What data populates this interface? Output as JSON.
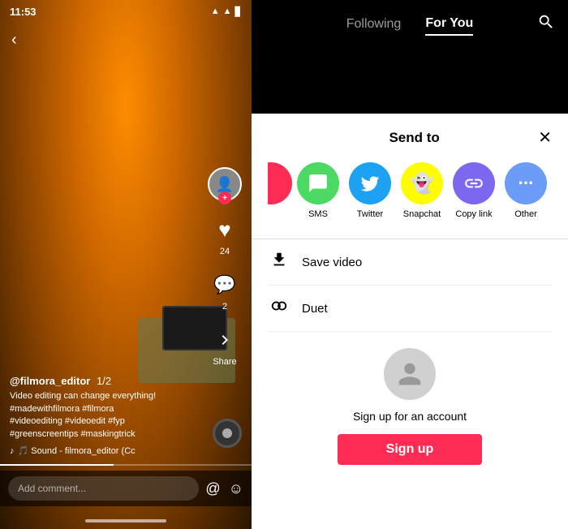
{
  "left_panel": {
    "status_time": "11:53",
    "username": "@filmora_editor",
    "date": "1/2",
    "caption": "Video editing can change everything!\n#madewithfilmora #filmora\n#videoediting #videoedit #fyp\n#greenscreentips #maskingtrick",
    "music": "🎵 Sound - filmora_editor (Cc",
    "comment_placeholder": "Add comment...",
    "like_count": "24",
    "comment_count": "2"
  },
  "right_panel": {
    "nav": {
      "following_label": "Following",
      "for_you_label": "For You",
      "active_tab": "for_you"
    },
    "send_to": {
      "title": "Send to",
      "close_icon": "✕",
      "share_items": [
        {
          "id": "sms",
          "label": "SMS",
          "bg_class": "sms-circle",
          "icon": "💬"
        },
        {
          "id": "twitter",
          "label": "Twitter",
          "bg_class": "twitter-circle",
          "icon": "🐦"
        },
        {
          "id": "snapchat",
          "label": "Snapchat",
          "bg_class": "snapchat-circle",
          "icon": "👻"
        },
        {
          "id": "copy_link",
          "label": "Copy link",
          "bg_class": "copylink-circle",
          "icon": "🔗"
        },
        {
          "id": "other",
          "label": "Other",
          "bg_class": "other-circle",
          "icon": "···"
        }
      ],
      "save_video_label": "Save video",
      "duet_label": "Duet",
      "signup_prompt": "Sign up for an account",
      "signup_btn_label": "Sign up"
    }
  }
}
